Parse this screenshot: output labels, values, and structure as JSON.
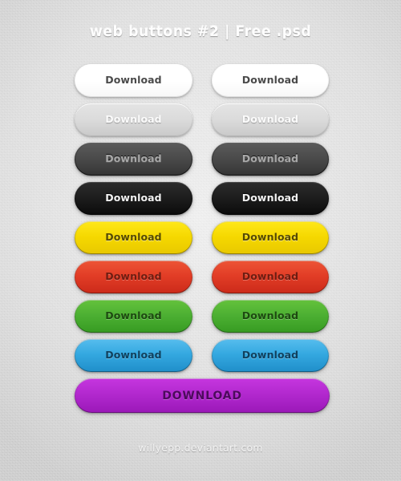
{
  "page": {
    "title": "web buttons #2 | Free .psd",
    "footer": "willyepp.deviantart.com",
    "background_color": "#dcdcdc",
    "title_color": "#fdfdfd",
    "footer_color": "#f3f3f3"
  },
  "buttons": {
    "rows": [
      {
        "style": "white",
        "left": {
          "label": "Download",
          "fill": "#ffffff",
          "text_color": "#4a4a4a"
        },
        "right": {
          "label": "Download",
          "fill": "#ffffff",
          "text_color": "#4a4a4a"
        }
      },
      {
        "style": "silver",
        "left": {
          "label": "Download",
          "fill": "#dbdbdb",
          "text_color": "#fbfbfb"
        },
        "right": {
          "label": "Download",
          "fill": "#dbdbdb",
          "text_color": "#fbfbfb"
        }
      },
      {
        "style": "gray",
        "left": {
          "label": "Download",
          "fill": "#4a4a4a",
          "text_color": "#a9a9a9"
        },
        "right": {
          "label": "Download",
          "fill": "#4a4a4a",
          "text_color": "#a9a9a9"
        }
      },
      {
        "style": "black",
        "left": {
          "label": "Download",
          "fill": "#1d1d1d",
          "text_color": "#f2f2f2"
        },
        "right": {
          "label": "Download",
          "fill": "#1d1d1d",
          "text_color": "#f2f2f2"
        }
      },
      {
        "style": "yellow",
        "left": {
          "label": "Download",
          "fill": "#f5d800",
          "text_color": "#564a00"
        },
        "right": {
          "label": "Download",
          "fill": "#f5d800",
          "text_color": "#564a00"
        }
      },
      {
        "style": "red",
        "left": {
          "label": "Download",
          "fill": "#e23d26",
          "text_color": "#6e1c10"
        },
        "right": {
          "label": "Download",
          "fill": "#e23d26",
          "text_color": "#6e1c10"
        }
      },
      {
        "style": "green",
        "left": {
          "label": "Download",
          "fill": "#4db033",
          "text_color": "#1d4a10"
        },
        "right": {
          "label": "Download",
          "fill": "#4db033",
          "text_color": "#1d4a10"
        }
      },
      {
        "style": "blue",
        "left": {
          "label": "Download",
          "fill": "#34a8e0",
          "text_color": "#10415e"
        },
        "right": {
          "label": "Download",
          "fill": "#34a8e0",
          "text_color": "#10415e"
        }
      }
    ],
    "wide": {
      "label": "DOWNLOAD",
      "style": "purple",
      "fill": "#b329cf",
      "text_color": "#4c0a5c"
    }
  }
}
